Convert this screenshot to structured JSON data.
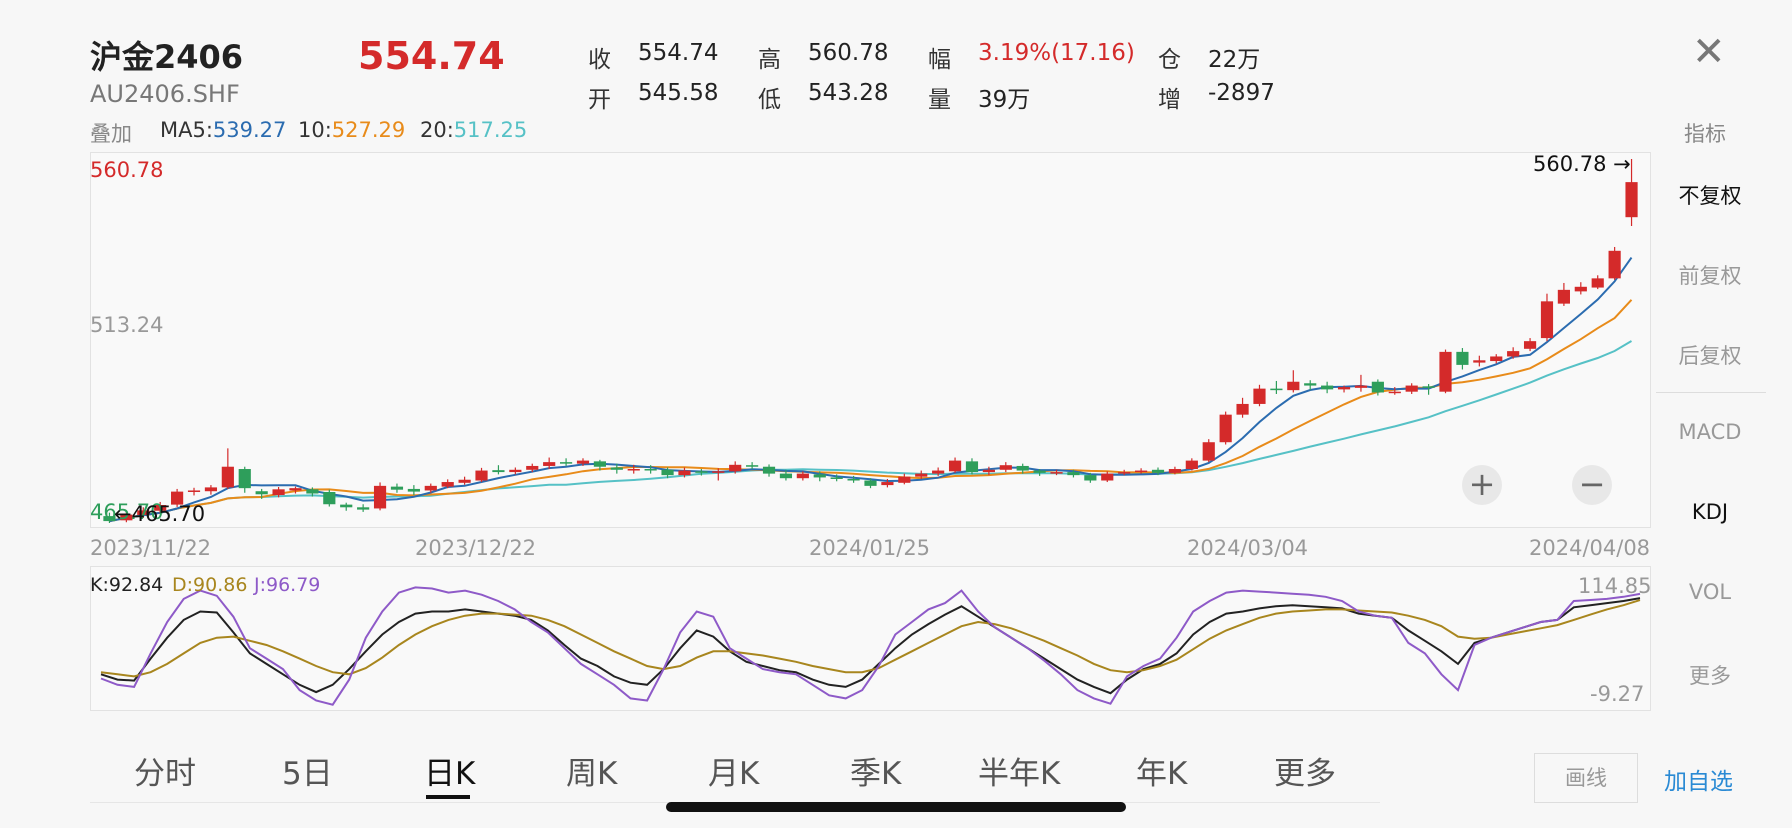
{
  "header": {
    "title": "沪金2406",
    "code": "AU2406.SHF",
    "price": "554.74",
    "close_icon": "close-icon"
  },
  "quote": {
    "close_label": "收",
    "close_value": "554.74",
    "open_label": "开",
    "open_value": "545.58",
    "high_label": "高",
    "high_value": "560.78",
    "low_label": "低",
    "low_value": "543.28",
    "change_label": "幅",
    "change_value": "3.19%(17.16)",
    "volume_label": "量",
    "volume_value": "39万",
    "position_label": "仓",
    "position_value": "22万",
    "increase_label": "增",
    "increase_value": "-2897"
  },
  "ma": {
    "overlay_label": "叠加",
    "ma5_label": "MA5:",
    "ma5_value": "539.27",
    "ma10_label": "10:",
    "ma10_value": "527.29",
    "ma20_label": "20:",
    "ma20_value": "517.25",
    "indicator_label": "指标"
  },
  "colors": {
    "up": "#d42a2a",
    "down": "#2e9e5b",
    "ma5": "#2b6cb0",
    "ma10": "#e88b1a",
    "ma20": "#56c1c6",
    "k": "#222222",
    "d": "#a8861e",
    "j": "#8e5ac8",
    "accent": "#2a8ad4"
  },
  "chart_data": [
    {
      "type": "candlestick",
      "y_labels": [
        "560.78",
        "513.24"
      ],
      "high_annotation": "560.78",
      "low_annotation": "465.70",
      "x_labels": [
        "2023/11/22",
        "2023/12/22",
        "2024/01/25",
        "2024/03/04",
        "2024/04/08"
      ],
      "ylim": [
        465.7,
        560.78
      ],
      "candles": [
        {
          "o": 467.5,
          "c": 466.2,
          "h": 468.4,
          "l": 465.7
        },
        {
          "o": 466.4,
          "c": 467.9,
          "h": 468.6,
          "l": 465.9
        },
        {
          "o": 467.8,
          "c": 469.0,
          "h": 469.8,
          "l": 467.0
        },
        {
          "o": 468.9,
          "c": 470.4,
          "h": 471.2,
          "l": 468.2
        },
        {
          "o": 470.5,
          "c": 473.9,
          "h": 474.6,
          "l": 469.9
        },
        {
          "o": 473.8,
          "c": 474.2,
          "h": 474.9,
          "l": 472.9
        },
        {
          "o": 474.0,
          "c": 475.0,
          "h": 475.6,
          "l": 473.1
        },
        {
          "o": 475.0,
          "c": 480.4,
          "h": 485.2,
          "l": 474.6
        },
        {
          "o": 479.8,
          "c": 474.8,
          "h": 480.4,
          "l": 473.6
        },
        {
          "o": 474.0,
          "c": 473.2,
          "h": 474.6,
          "l": 472.0
        },
        {
          "o": 473.0,
          "c": 474.5,
          "h": 475.1,
          "l": 472.4
        },
        {
          "o": 474.2,
          "c": 474.8,
          "h": 475.2,
          "l": 473.4
        },
        {
          "o": 474.5,
          "c": 473.4,
          "h": 475.0,
          "l": 472.6
        },
        {
          "o": 473.8,
          "c": 470.6,
          "h": 474.4,
          "l": 470.0
        },
        {
          "o": 470.5,
          "c": 469.8,
          "h": 471.0,
          "l": 468.9
        },
        {
          "o": 469.8,
          "c": 469.2,
          "h": 470.6,
          "l": 468.6
        },
        {
          "o": 469.5,
          "c": 475.4,
          "h": 476.3,
          "l": 469.0
        },
        {
          "o": 475.2,
          "c": 474.4,
          "h": 476.0,
          "l": 473.6
        },
        {
          "o": 474.6,
          "c": 473.9,
          "h": 475.6,
          "l": 473.0
        },
        {
          "o": 474.2,
          "c": 475.4,
          "h": 476.0,
          "l": 473.6
        },
        {
          "o": 475.2,
          "c": 476.4,
          "h": 477.1,
          "l": 474.8
        },
        {
          "o": 476.2,
          "c": 477.0,
          "h": 477.8,
          "l": 475.7
        },
        {
          "o": 476.8,
          "c": 479.4,
          "h": 480.1,
          "l": 476.4
        },
        {
          "o": 479.5,
          "c": 479.0,
          "h": 480.8,
          "l": 478.4
        },
        {
          "o": 479.0,
          "c": 479.6,
          "h": 480.2,
          "l": 478.4
        },
        {
          "o": 479.6,
          "c": 480.6,
          "h": 481.2,
          "l": 479.0
        },
        {
          "o": 480.6,
          "c": 481.6,
          "h": 482.8,
          "l": 479.8
        },
        {
          "o": 481.6,
          "c": 481.2,
          "h": 482.6,
          "l": 480.6
        },
        {
          "o": 481.2,
          "c": 482.0,
          "h": 482.6,
          "l": 480.6
        },
        {
          "o": 481.8,
          "c": 480.4,
          "h": 482.2,
          "l": 479.4
        },
        {
          "o": 480.2,
          "c": 479.6,
          "h": 481.2,
          "l": 478.6
        },
        {
          "o": 479.7,
          "c": 479.8,
          "h": 480.9,
          "l": 478.6
        },
        {
          "o": 479.8,
          "c": 479.6,
          "h": 480.8,
          "l": 478.6
        },
        {
          "o": 479.6,
          "c": 478.2,
          "h": 480.2,
          "l": 477.4
        },
        {
          "o": 478.2,
          "c": 479.4,
          "h": 480.2,
          "l": 477.6
        },
        {
          "o": 479.2,
          "c": 478.8,
          "h": 479.8,
          "l": 478.1
        },
        {
          "o": 478.8,
          "c": 479.2,
          "h": 480.0,
          "l": 476.8
        },
        {
          "o": 479.2,
          "c": 480.9,
          "h": 481.8,
          "l": 478.6
        },
        {
          "o": 480.8,
          "c": 480.4,
          "h": 481.6,
          "l": 479.8
        },
        {
          "o": 480.4,
          "c": 478.6,
          "h": 481.0,
          "l": 477.8
        },
        {
          "o": 478.6,
          "c": 477.4,
          "h": 479.6,
          "l": 476.8
        },
        {
          "o": 477.4,
          "c": 478.6,
          "h": 479.2,
          "l": 476.8
        },
        {
          "o": 478.4,
          "c": 477.6,
          "h": 479.2,
          "l": 476.6
        },
        {
          "o": 477.6,
          "c": 477.2,
          "h": 478.4,
          "l": 476.6
        },
        {
          "o": 477.2,
          "c": 476.8,
          "h": 478.0,
          "l": 476.2
        },
        {
          "o": 476.8,
          "c": 475.4,
          "h": 477.4,
          "l": 474.8
        },
        {
          "o": 475.6,
          "c": 476.4,
          "h": 477.2,
          "l": 475.0
        },
        {
          "o": 476.2,
          "c": 477.8,
          "h": 478.6,
          "l": 475.8
        },
        {
          "o": 477.8,
          "c": 478.6,
          "h": 479.4,
          "l": 477.2
        },
        {
          "o": 478.6,
          "c": 479.4,
          "h": 480.2,
          "l": 478.0
        },
        {
          "o": 479.2,
          "c": 482.0,
          "h": 482.8,
          "l": 478.8
        },
        {
          "o": 481.8,
          "c": 479.0,
          "h": 482.6,
          "l": 478.4
        },
        {
          "o": 479.0,
          "c": 479.6,
          "h": 480.4,
          "l": 478.2
        },
        {
          "o": 479.6,
          "c": 480.8,
          "h": 481.6,
          "l": 479.0
        },
        {
          "o": 480.6,
          "c": 479.4,
          "h": 481.2,
          "l": 478.6
        },
        {
          "o": 479.4,
          "c": 478.8,
          "h": 479.8,
          "l": 478.0
        },
        {
          "o": 478.8,
          "c": 479.0,
          "h": 479.6,
          "l": 478.2
        },
        {
          "o": 479.0,
          "c": 478.2,
          "h": 479.6,
          "l": 477.6
        },
        {
          "o": 478.2,
          "c": 476.8,
          "h": 478.8,
          "l": 476.2
        },
        {
          "o": 476.8,
          "c": 478.6,
          "h": 479.2,
          "l": 476.4
        },
        {
          "o": 478.6,
          "c": 479.0,
          "h": 479.6,
          "l": 478.2
        },
        {
          "o": 479.0,
          "c": 479.4,
          "h": 480.0,
          "l": 478.6
        },
        {
          "o": 479.6,
          "c": 478.8,
          "h": 480.2,
          "l": 478.2
        },
        {
          "o": 478.8,
          "c": 479.8,
          "h": 480.4,
          "l": 478.4
        },
        {
          "o": 479.8,
          "c": 482.0,
          "h": 482.6,
          "l": 479.4
        },
        {
          "o": 482.0,
          "c": 486.8,
          "h": 487.6,
          "l": 481.6
        },
        {
          "o": 486.8,
          "c": 494.0,
          "h": 494.8,
          "l": 486.2
        },
        {
          "o": 494.0,
          "c": 496.8,
          "h": 498.4,
          "l": 493.2
        },
        {
          "o": 496.8,
          "c": 500.8,
          "h": 501.8,
          "l": 496.2
        },
        {
          "o": 500.8,
          "c": 500.4,
          "h": 502.8,
          "l": 499.4
        },
        {
          "o": 500.4,
          "c": 502.6,
          "h": 505.6,
          "l": 499.8
        },
        {
          "o": 502.2,
          "c": 501.6,
          "h": 503.0,
          "l": 500.4
        },
        {
          "o": 501.6,
          "c": 500.6,
          "h": 502.6,
          "l": 499.6
        },
        {
          "o": 500.6,
          "c": 501.2,
          "h": 501.6,
          "l": 499.8
        },
        {
          "o": 501.0,
          "c": 501.6,
          "h": 504.4,
          "l": 500.0
        },
        {
          "o": 502.6,
          "c": 499.8,
          "h": 503.2,
          "l": 499.0
        },
        {
          "o": 499.8,
          "c": 500.0,
          "h": 501.2,
          "l": 499.2
        },
        {
          "o": 500.0,
          "c": 501.6,
          "h": 502.2,
          "l": 499.4
        },
        {
          "o": 501.4,
          "c": 501.0,
          "h": 502.0,
          "l": 499.2
        },
        {
          "o": 500.0,
          "c": 510.4,
          "h": 511.0,
          "l": 499.6
        },
        {
          "o": 510.4,
          "c": 507.0,
          "h": 511.4,
          "l": 505.8
        },
        {
          "o": 507.6,
          "c": 508.2,
          "h": 509.4,
          "l": 506.6
        },
        {
          "o": 508.0,
          "c": 509.2,
          "h": 509.8,
          "l": 507.4
        },
        {
          "o": 509.2,
          "c": 510.6,
          "h": 511.6,
          "l": 508.6
        },
        {
          "o": 511.2,
          "c": 513.2,
          "h": 514.0,
          "l": 510.6
        },
        {
          "o": 514.0,
          "c": 523.6,
          "h": 525.6,
          "l": 513.2
        },
        {
          "o": 523.0,
          "c": 526.6,
          "h": 528.4,
          "l": 522.4
        },
        {
          "o": 526.2,
          "c": 527.4,
          "h": 528.6,
          "l": 525.4
        },
        {
          "o": 527.2,
          "c": 529.6,
          "h": 530.4,
          "l": 526.8
        },
        {
          "o": 529.6,
          "c": 536.8,
          "h": 537.8,
          "l": 529.2
        },
        {
          "o": 545.58,
          "c": 554.74,
          "h": 560.78,
          "l": 543.28
        }
      ]
    },
    {
      "type": "line",
      "title_labels": [
        "K:92.84",
        "D:90.86",
        "J:96.79"
      ],
      "y_labels": [
        "114.85",
        "-9.27"
      ],
      "ylim": [
        -9.27,
        114.85
      ],
      "series": [
        {
          "name": "K",
          "values": [
            20,
            15,
            14,
            35,
            55,
            72,
            80,
            79,
            60,
            40,
            30,
            20,
            10,
            3,
            10,
            25,
            42,
            58,
            70,
            78,
            80,
            80,
            82,
            80,
            78,
            76,
            72,
            62,
            48,
            35,
            28,
            18,
            12,
            10,
            25,
            45,
            62,
            56,
            42,
            32,
            28,
            24,
            22,
            15,
            10,
            8,
            15,
            30,
            45,
            58,
            68,
            77,
            85,
            75,
            65,
            55,
            45,
            35,
            25,
            15,
            8,
            2,
            15,
            25,
            30,
            40,
            58,
            70,
            78,
            80,
            83,
            85,
            86,
            85,
            84,
            83,
            78,
            76,
            74,
            62,
            52,
            42,
            30,
            50,
            55,
            60,
            65,
            70,
            72,
            84,
            86,
            88,
            90,
            92.84
          ]
        },
        {
          "name": "D",
          "values": [
            22,
            20,
            18,
            22,
            30,
            40,
            50,
            55,
            56,
            52,
            48,
            42,
            35,
            28,
            22,
            20,
            26,
            36,
            48,
            58,
            66,
            72,
            76,
            78,
            78,
            77,
            76,
            72,
            66,
            58,
            50,
            42,
            35,
            28,
            25,
            28,
            36,
            42,
            42,
            40,
            38,
            35,
            32,
            28,
            25,
            22,
            22,
            26,
            34,
            42,
            50,
            58,
            66,
            70,
            68,
            64,
            58,
            52,
            45,
            38,
            30,
            24,
            22,
            24,
            28,
            34,
            44,
            54,
            62,
            68,
            74,
            78,
            80,
            81,
            82,
            82,
            81,
            80,
            79,
            76,
            72,
            66,
            56,
            54,
            55,
            58,
            61,
            64,
            67,
            72,
            77,
            82,
            86,
            90.86
          ]
        },
        {
          "name": "J",
          "values": [
            16,
            10,
            8,
            40,
            70,
            92,
            100,
            95,
            75,
            45,
            35,
            25,
            5,
            -5,
            -9,
            15,
            55,
            80,
            98,
            103,
            102,
            98,
            100,
            96,
            90,
            82,
            70,
            60,
            45,
            30,
            20,
            10,
            -3,
            -5,
            25,
            60,
            80,
            75,
            45,
            35,
            25,
            22,
            20,
            10,
            0,
            -3,
            5,
            28,
            58,
            70,
            82,
            88,
            100,
            80,
            65,
            55,
            45,
            33,
            20,
            5,
            -3,
            -8,
            18,
            28,
            35,
            55,
            80,
            90,
            98,
            100,
            99,
            98,
            97,
            96,
            94,
            90,
            80,
            76,
            74,
            50,
            40,
            20,
            5,
            48,
            55,
            60,
            65,
            70,
            72,
            90,
            91,
            92,
            94,
            96.79
          ]
        }
      ]
    }
  ],
  "annotations": {
    "kline_high": "560.78 →",
    "kline_low": "←465.70",
    "kline_y_top": "560.78",
    "kline_y_mid": "513.24",
    "kline_y_bottom": "465.70"
  },
  "sidebar": {
    "items": [
      "不复权",
      "前复权",
      "后复权",
      "MACD",
      "KDJ",
      "VOL",
      "更多"
    ]
  },
  "zoom": {
    "plus": "+",
    "minus": "−"
  },
  "tabs": [
    "分时",
    "5日",
    "日K",
    "周K",
    "月K",
    "季K",
    "半年K",
    "年K",
    "更多"
  ],
  "bottom": {
    "draw_button": "画线",
    "add_fav": "加自选"
  }
}
